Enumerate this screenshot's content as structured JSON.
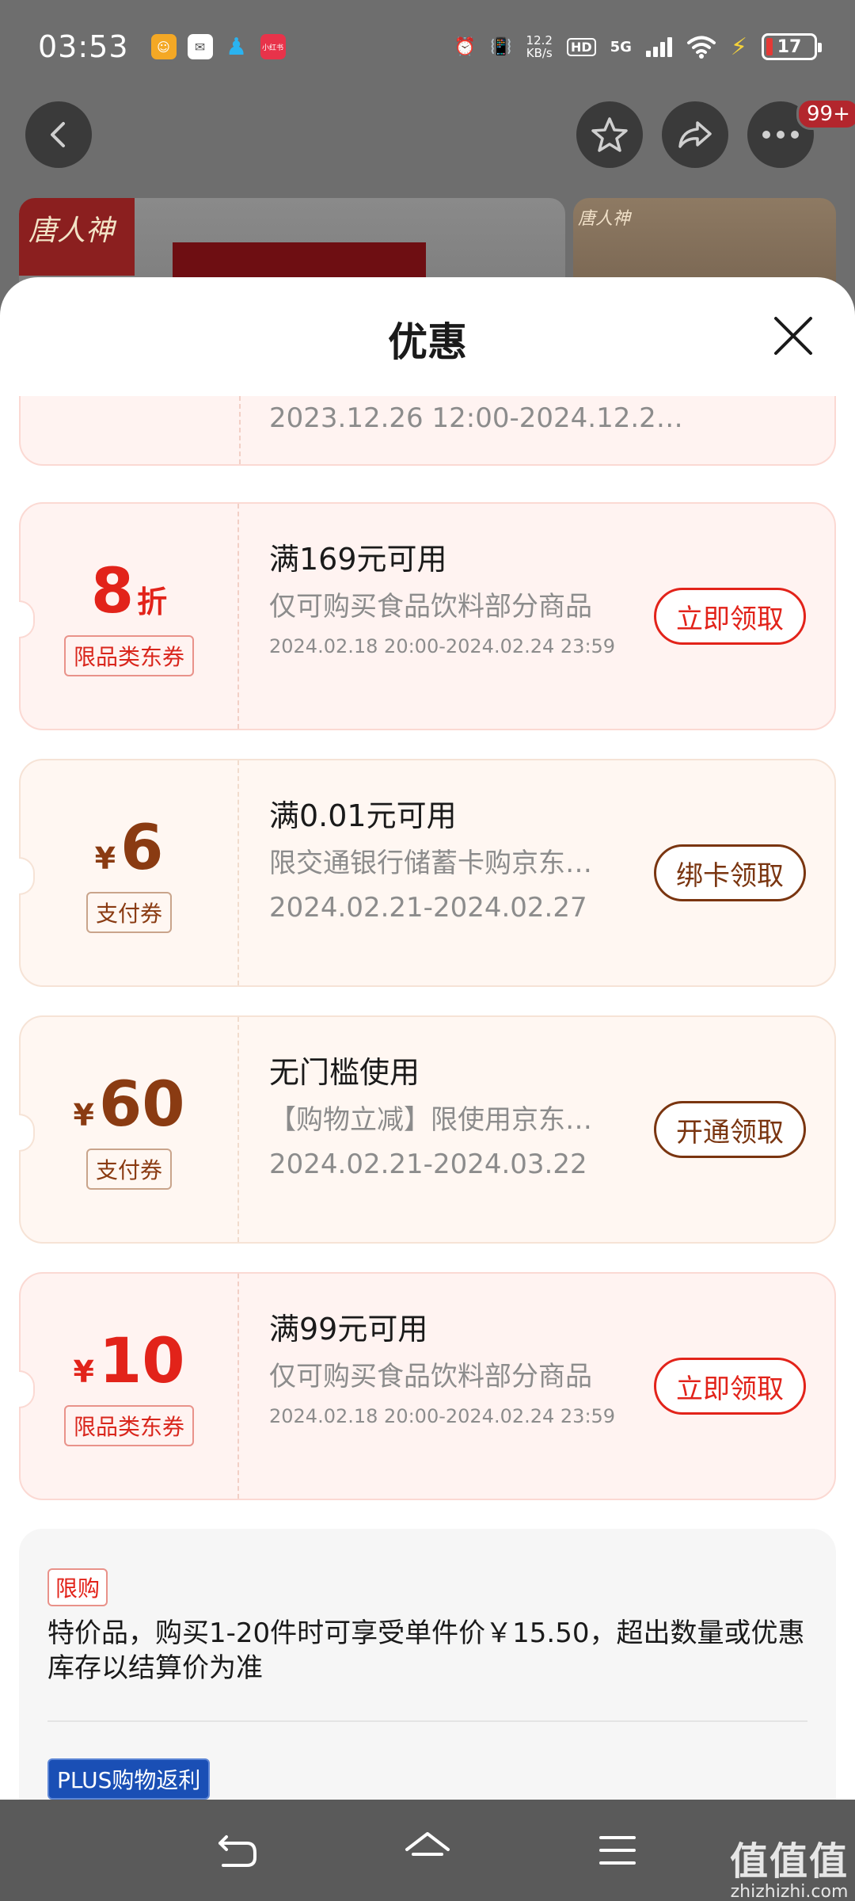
{
  "status_bar": {
    "time": "03:53",
    "net_speed_value": "12.2",
    "net_speed_unit": "KB/s",
    "hd": "HD",
    "network": "5G",
    "battery": "17",
    "notif_tiktok_label": "小红书"
  },
  "header": {
    "more_badge": "99+"
  },
  "product_images": {
    "brand_logo": "唐人神"
  },
  "sheet": {
    "title": "优惠"
  },
  "partial_coupon": {
    "date": "2023.12.26 12:00-2024.12.2…"
  },
  "coupons": [
    {
      "amount": "8",
      "unit": "折",
      "tag": "限品类东券",
      "condition": "满169元可用",
      "desc": "仅可购买食品饮料部分商品",
      "date": "2024.02.18 20:00-2024.02.24 23:59",
      "button": "立即领取"
    },
    {
      "yen": "¥",
      "amount": "6",
      "tag": "支付券",
      "condition": "满0.01元可用",
      "desc": "限交通银行储蓄卡购京东…",
      "date": "2024.02.21-2024.02.27",
      "button": "绑卡领取"
    },
    {
      "yen": "¥",
      "amount": "60",
      "tag": "支付券",
      "condition": "无门槛使用",
      "desc": "【购物立减】限使用京东…",
      "date": "2024.02.21-2024.03.22",
      "button": "开通领取"
    },
    {
      "yen": "¥",
      "amount": "10",
      "tag": "限品类东券",
      "condition": "满99元可用",
      "desc": "仅可购买食品饮料部分商品",
      "date": "2024.02.18 20:00-2024.02.24 23:59",
      "button": "立即领取"
    }
  ],
  "limit_section": {
    "tag": "限购",
    "text": "特价品，购买1-20件时可享受单件价￥15.50，超出数量或优惠库存以结算价为准",
    "plus_tag": "PLUS购物返利"
  },
  "watermark": {
    "top": "值值值",
    "bottom": "zhizhizhi.com"
  },
  "colors": {
    "red_accent": "#e2231a",
    "brown_accent": "#8a3b12",
    "plus_blue": "#1a4fb5"
  }
}
